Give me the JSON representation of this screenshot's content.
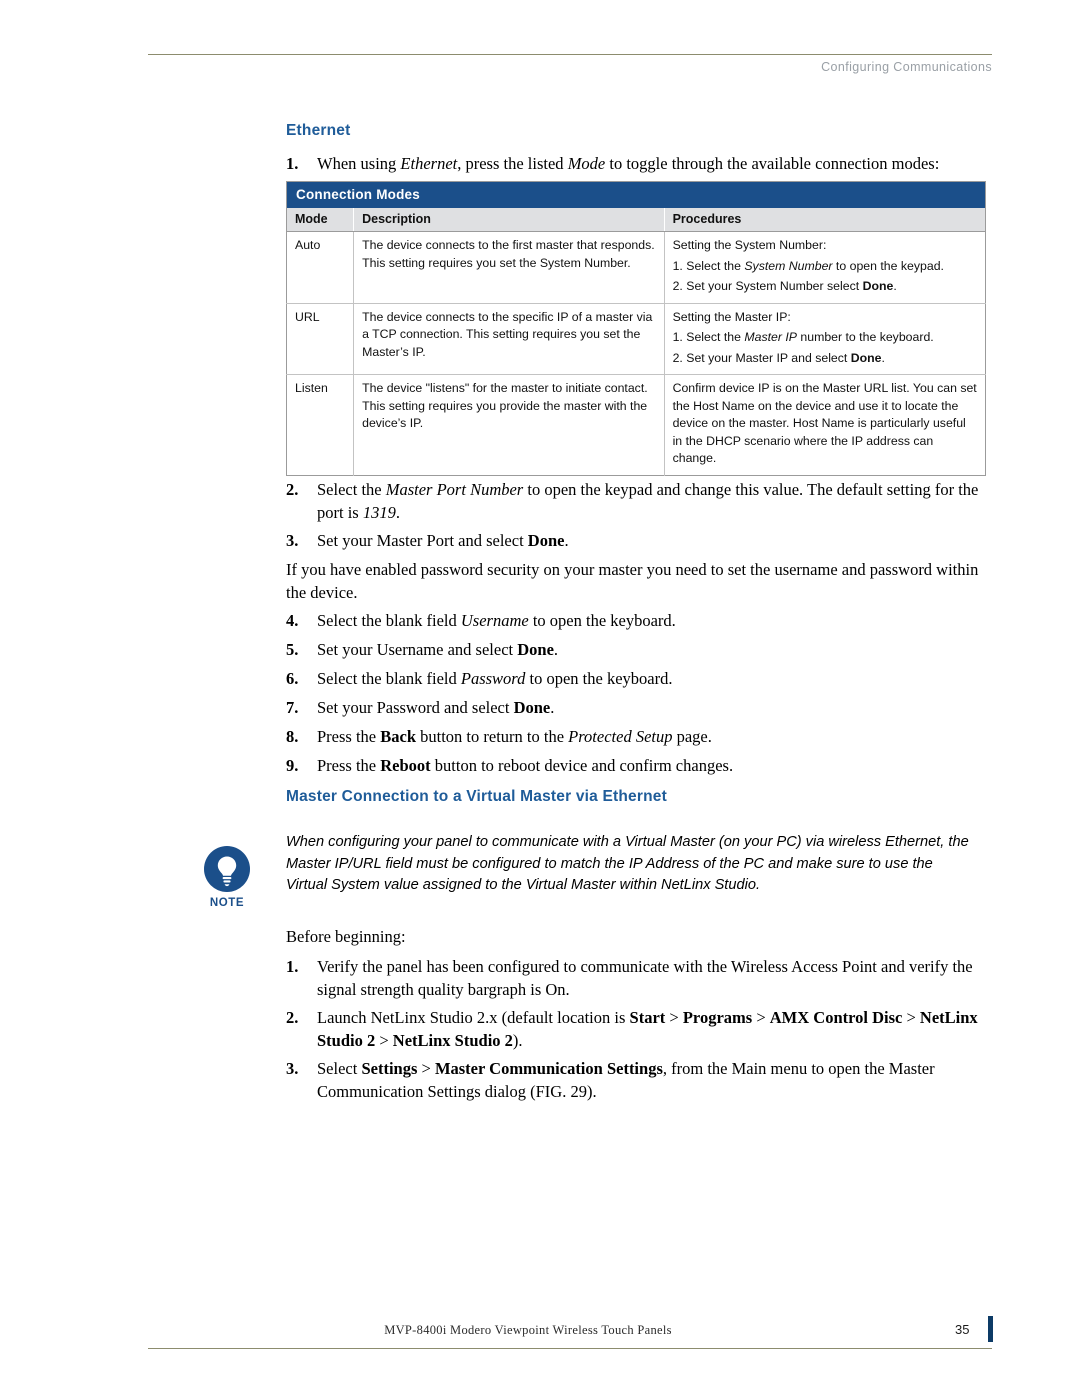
{
  "header": {
    "running_head": "Configuring Communications"
  },
  "footer": {
    "doc_title": "MVP-8400i Modero Viewpoint Wireless Touch Panels",
    "page_number": "35"
  },
  "section": {
    "ethernet_heading": "Ethernet",
    "master_connection_heading": "Master Connection to a Virtual Master via Ethernet"
  },
  "steps_ethernet": [
    {
      "num": "1.",
      "html": "When using <i>Ethernet</i>, press the listed <i>Mode</i> to toggle through the available connection modes:"
    },
    {
      "num": "2.",
      "html": "Select the <i>Master Port Number</i> to open the keypad and change this value. The default setting for the port is <i>1319</i>."
    },
    {
      "num": "3.",
      "html": "Set your Master Port and select <b>Done</b>."
    },
    {
      "num": "4.",
      "html": "Select the blank field <i>Username</i> to open the keyboard."
    },
    {
      "num": "5.",
      "html": "Set your Username and select <b>Done</b>."
    },
    {
      "num": "6.",
      "html": "Select the blank field <i>Password</i> to open the keyboard."
    },
    {
      "num": "7.",
      "html": "Set your Password and select <b>Done</b>."
    },
    {
      "num": "8.",
      "html": "Press the <b>Back</b> button to return to the <i>Protected Setup</i> page."
    },
    {
      "num": "9.",
      "html": "Press the <b>Reboot</b> button to reboot device and confirm changes."
    }
  ],
  "paragraph_password": "If you have enabled password security on your master you need to set the username and password within the device.",
  "note": {
    "label": "NOTE",
    "text": "When configuring your panel to communicate with a Virtual Master (on your PC) via wireless Ethernet, the Master IP/URL field must be configured to match the IP Address of the PC and make sure to use the Virtual System value assigned to the Virtual Master within NetLinx Studio."
  },
  "before_beginning_label": "Before beginning:",
  "steps_before_beginning": [
    {
      "num": "1.",
      "html": "Verify the panel has been configured to communicate with the Wireless Access Point and verify the signal strength quality bargraph is On."
    },
    {
      "num": "2.",
      "html": "Launch NetLinx Studio 2.x (default location is <b>Start</b> &gt; <b>Programs</b> &gt; <b>AMX Control Disc</b> &gt; <b>NetLinx Studio 2</b> &gt; <b>NetLinx Studio 2</b>)."
    },
    {
      "num": "3.",
      "html": "Select <b>Settings</b> &gt; <b>Master Communication Settings</b>, from the Main menu to open the Master Communication Settings dialog (FIG. 29)."
    }
  ],
  "table": {
    "title": "Connection Modes",
    "columns": [
      "Mode",
      "Description",
      "Procedures"
    ],
    "rows": [
      {
        "mode": "Auto",
        "description": "The device connects to the first master that responds. This setting requires you set the System Number.",
        "procedure_intro": "Setting the System Number:",
        "procedure_steps": [
          "1.  Select the <i>System Number</i> to open the keypad.",
          "2.  Set your System Number select <b>Done</b>."
        ]
      },
      {
        "mode": "URL",
        "description": "The device connects to the specific IP of a master via a TCP connection. This setting requires you set the Master’s IP.",
        "procedure_intro": "Setting the Master IP:",
        "procedure_steps": [
          "1.  Select the <i>Master IP</i> number to the keyboard.",
          "2.  Set your Master IP and select <b>Done</b>."
        ]
      },
      {
        "mode": "Listen",
        "description": "The device \"listens\" for the master to initiate contact. This setting requires you provide the master with the device’s IP.",
        "procedure_intro": "Confirm device IP is on the Master URL list. You can set the Host Name on the device and use it to locate the device on the master. Host Name is particularly useful in the DHCP scenario where the IP address can change.",
        "procedure_steps": []
      }
    ]
  },
  "colors": {
    "heading_blue": "#1f5c99",
    "table_title_bg": "#1b4f8a",
    "table_header_bg": "#dfe0e2",
    "rule": "#8c8c6e"
  }
}
